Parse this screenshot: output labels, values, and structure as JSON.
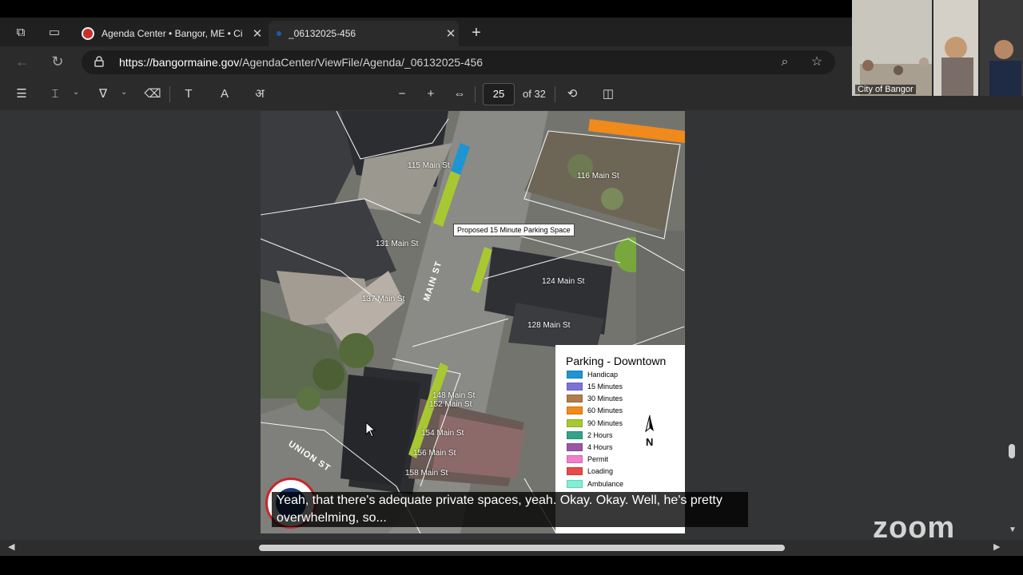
{
  "browser": {
    "tabs": [
      {
        "title": "Agenda Center • Bangor, ME • Ci",
        "active": false
      },
      {
        "title": "_06132025-456",
        "active": true
      }
    ],
    "url_host": "https://bangormaine.gov",
    "url_path": "/AgendaCenter/ViewFile/Agenda/_06132025-456"
  },
  "pdf_toolbar": {
    "page_current": "25",
    "page_total_label": "of 32",
    "zoom_out": "−",
    "zoom_in": "+"
  },
  "map": {
    "callout": "Proposed 15 Minute Parking Space",
    "street_main": "MAIN ST",
    "street_union": "UNION ST",
    "addresses": [
      "115 Main St",
      "116 Main St",
      "131 Main St",
      "124 Main St",
      "137 Main St",
      "128 Main St",
      "148 Main St",
      "152 Main St",
      "154 Main St",
      "156 Main St",
      "158 Main St"
    ],
    "legend": {
      "title": "Parking - Downtown",
      "items": [
        {
          "label": "Handicap",
          "color": "#1d95d3"
        },
        {
          "label": "15 Minutes",
          "color": "#7b73d6"
        },
        {
          "label": "30 Minutes",
          "color": "#b07d4a"
        },
        {
          "label": "60 Minutes",
          "color": "#f08a1c"
        },
        {
          "label": "90 Minutes",
          "color": "#a8c832"
        },
        {
          "label": "2 Hours",
          "color": "#2fa58a"
        },
        {
          "label": "4 Hours",
          "color": "#9a56a5"
        },
        {
          "label": "Permit",
          "color": "#f27fc8"
        },
        {
          "label": "Loading",
          "color": "#e84a4a"
        },
        {
          "label": "Ambulance",
          "color": "#7ef0d6"
        }
      ],
      "north": "N"
    }
  },
  "caption": {
    "line1": "Yeah, that there's adequate private spaces, yeah. Okay. Okay. Well, he's pretty",
    "line2": "overwhelming, so..."
  },
  "video": {
    "label": "City of Bangor"
  },
  "watermark": "zoom"
}
